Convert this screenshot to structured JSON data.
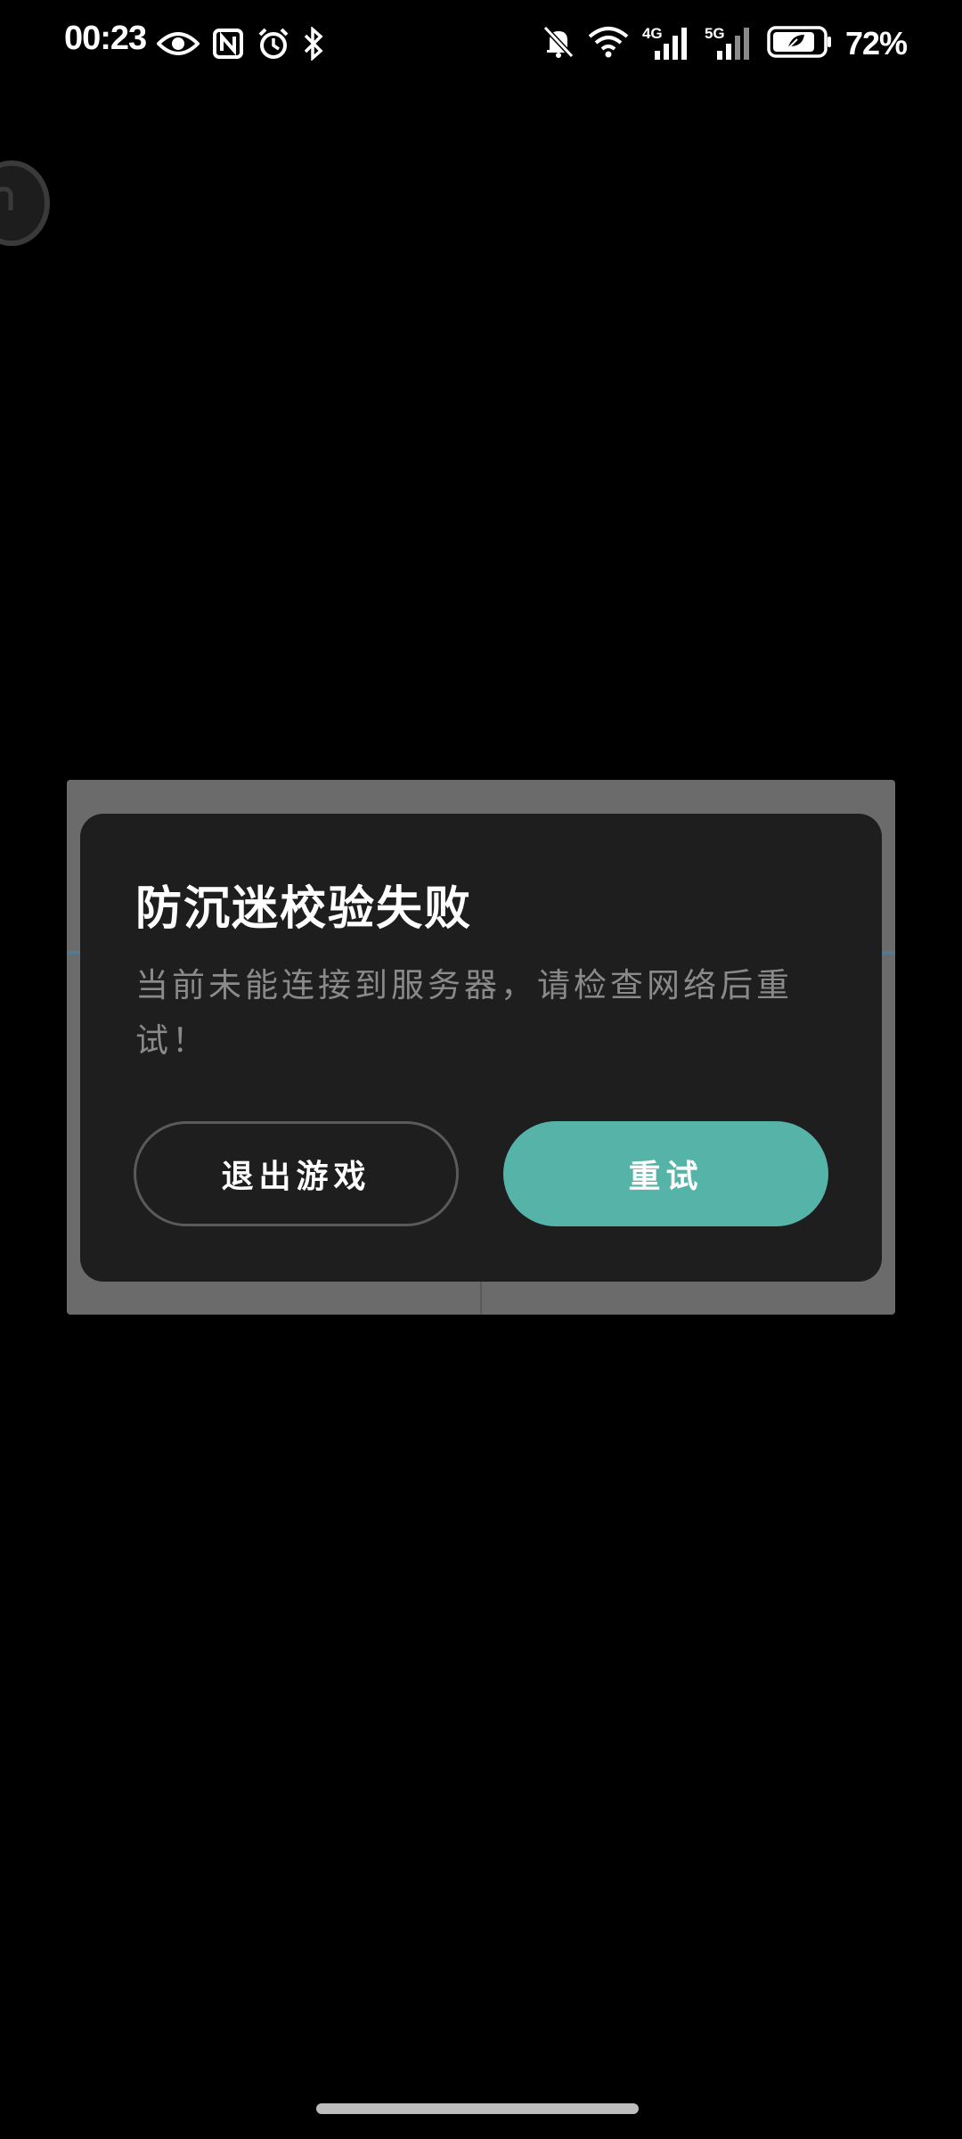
{
  "status_bar": {
    "time": "00:23",
    "battery": "72%",
    "left_icons": [
      "eye-icon",
      "nfc-icon",
      "alarm-icon",
      "bluetooth-icon"
    ],
    "right_icons": [
      "mute-icon",
      "wifi-icon",
      "signal-4g-icon",
      "signal-5g-icon",
      "battery-saver-icon"
    ],
    "net_labels": {
      "first": "4G",
      "second": "5G"
    }
  },
  "dialog": {
    "title": "防沉迷校验失败",
    "message": "当前未能连接到服务器，请检查网络后重试！",
    "exit_label": "退出游戏",
    "retry_label": "重试"
  },
  "colors": {
    "accent": "#55b3a8",
    "dialog_bg": "#1e1e1e",
    "backdrop": "#000000"
  }
}
